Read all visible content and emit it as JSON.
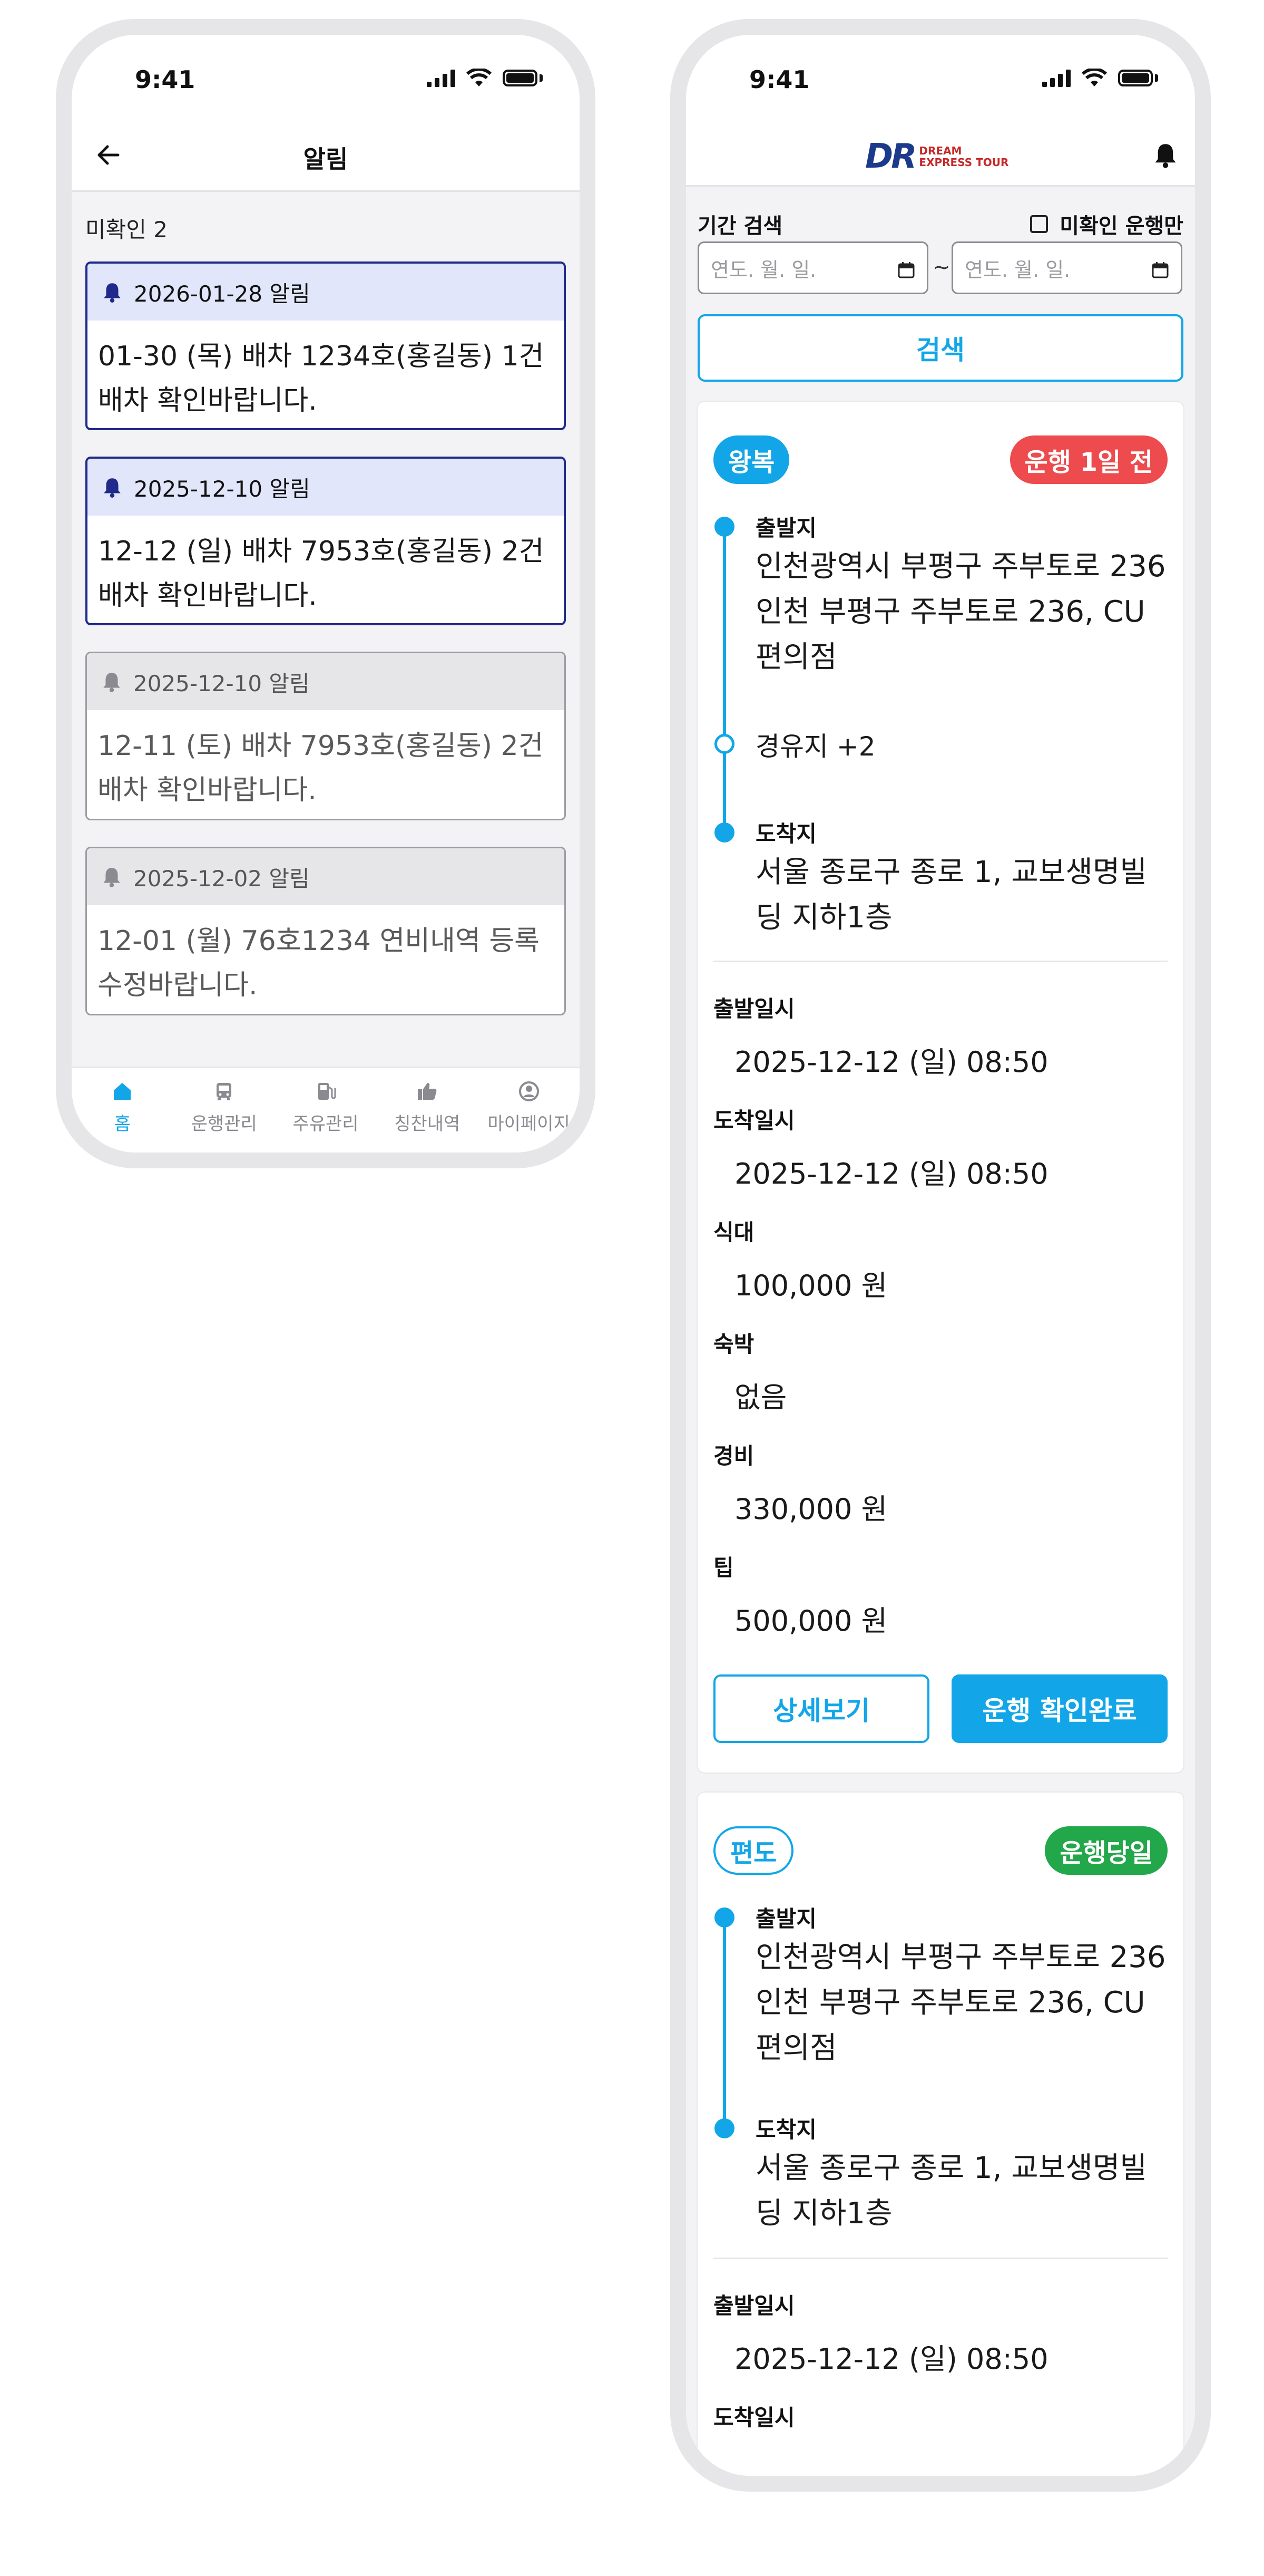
{
  "status": {
    "time": "9:41"
  },
  "notifications": {
    "title": "알림",
    "unread_label": "미확인 2",
    "items": [
      {
        "header": "2026-01-28 알림",
        "body": "01-30 (목) 배차 1234호(홍길동) 1건 배차 확인바랍니다.",
        "read": false
      },
      {
        "header": "2025-12-10 알림",
        "body": "12-12 (일) 배차 7953호(홍길동) 2건 배차 확인바랍니다.",
        "read": false
      },
      {
        "header": "2025-12-10 알림",
        "body": "12-11 (토) 배차 7953호(홍길동) 2건 배차 확인바랍니다.",
        "read": true
      },
      {
        "header": "2025-12-02 알림",
        "body": "12-01 (월) 76호1234 연비내역 등록 수정바랍니다.",
        "read": true
      }
    ]
  },
  "tabbar": {
    "items": [
      {
        "label": "홈",
        "icon": "home-icon",
        "active": true
      },
      {
        "label": "운행관리",
        "icon": "bus-icon",
        "active": false
      },
      {
        "label": "주유관리",
        "icon": "fuel-icon",
        "active": false
      },
      {
        "label": "칭찬내역",
        "icon": "thumbs-up-icon",
        "active": false
      },
      {
        "label": "마이페이지",
        "icon": "user-circle-icon",
        "active": false
      }
    ]
  },
  "operations": {
    "logo": {
      "mark": "DR",
      "line1": "DREAM",
      "line2": "EXPRESS TOUR"
    },
    "search_label": "기간 검색",
    "unconfirmed_only_label": "미확인 운행만",
    "date_placeholder": "연도. 월. 일.",
    "range_separator": "~",
    "search_button": "검색",
    "cards": [
      {
        "trip_type": "왕복",
        "status": "운행 1일 전",
        "departure_label": "출발지",
        "departure": "인천광역시 부평구 주부토로 236 인천 부평구 주부토로 236, CU 편의점",
        "via": "경유지 +2",
        "arrival_label": "도착지",
        "arrival": "서울 종로구 종로 1, 교보생명빌딩 지하1층",
        "fields": [
          {
            "label": "출발일시",
            "value": "2025-12-12 (일) 08:50"
          },
          {
            "label": "도착일시",
            "value": "2025-12-12 (일) 08:50"
          },
          {
            "label": "식대",
            "value": "100,000 원"
          },
          {
            "label": "숙박",
            "value": "없음"
          },
          {
            "label": "경비",
            "value": "330,000 원"
          },
          {
            "label": "팁",
            "value": "500,000 원"
          }
        ],
        "detail_button": "상세보기",
        "confirm_button": "운행 확인완료"
      },
      {
        "trip_type": "편도",
        "status": "운행당일",
        "departure_label": "출발지",
        "departure": "인천광역시 부평구 주부토로 236 인천 부평구 주부토로 236, CU 편의점",
        "arrival_label": "도착지",
        "arrival": "서울 종로구 종로 1, 교보생명빌딩 지하1층",
        "fields": [
          {
            "label": "출발일시",
            "value": "2025-12-12 (일) 08:50"
          },
          {
            "label": "도착일시",
            "value": ""
          }
        ]
      }
    ]
  },
  "colors": {
    "accent": "#12a6e8",
    "unread_border": "#1f2a8a",
    "status_red": "#ee4b4e",
    "status_green": "#22a74a"
  }
}
